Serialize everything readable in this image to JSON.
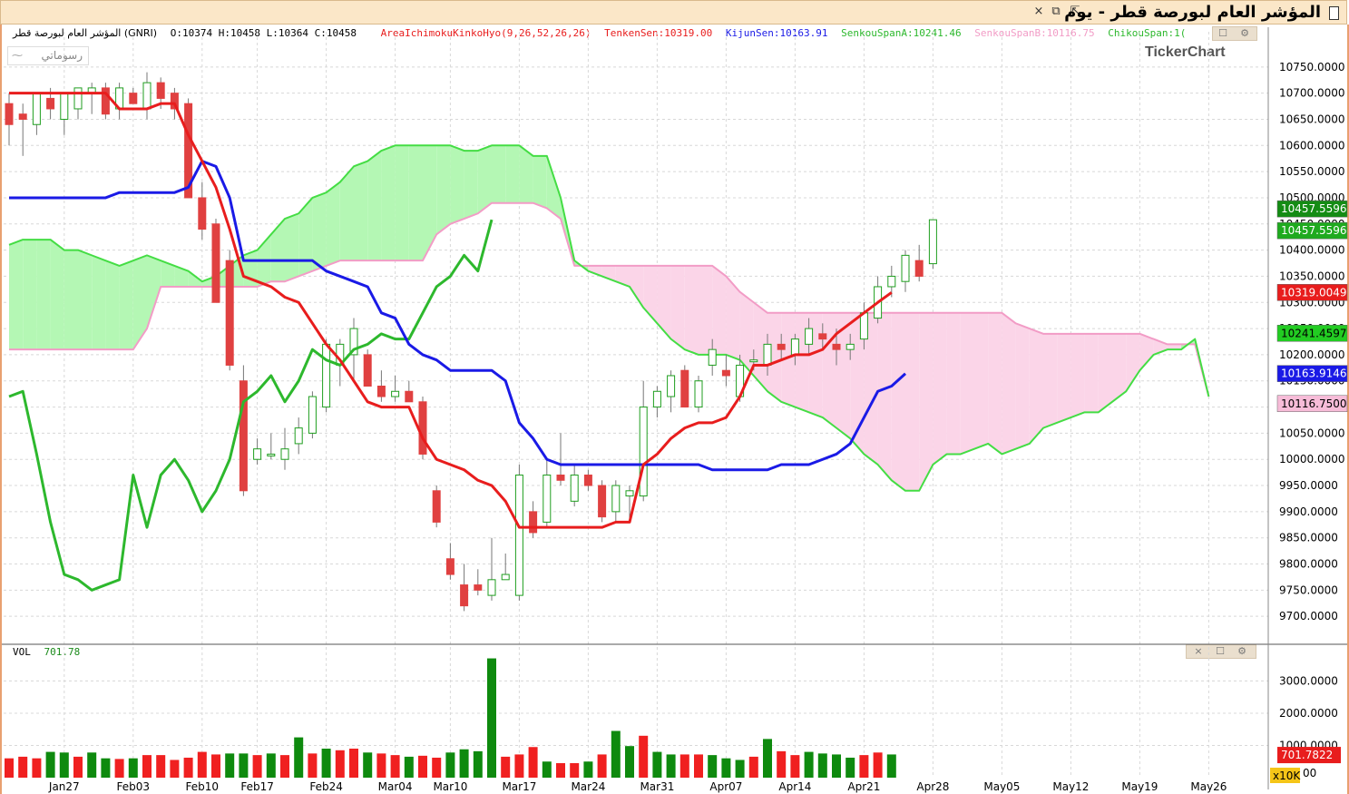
{
  "window": {
    "title": "المؤشر العام لبورصة قطر - يوم",
    "close_label": "×",
    "restore_label": "⧉",
    "detach_label": "⇱"
  },
  "legend": {
    "symbol_info": "المؤشر العام لبورصة قطر (GNRI)",
    "ohlc": "O:10374  H:10458  L:10364  C:10458",
    "indicator": "AreaIchimokuKinkoHyo(9,26,52,26,26)",
    "tenken": "TenkenSen:10319.00",
    "kijun": "KijunSen:10163.91",
    "spanA": "SenkouSpanA:10241.46",
    "spanB": "SenkouSpanB:10116.75",
    "chikou": "ChikouSpan:1("
  },
  "chart_type_label": "رسوماتي",
  "logo": "TickerChart",
  "volume_panel": {
    "label": "VOL",
    "value": "701.78",
    "multiplier": "x10K"
  },
  "colors": {
    "up": "#1f9e1f",
    "down": "#e04040",
    "tenken": "#e81d1d",
    "kijun": "#1a1ae6",
    "chikou": "#2db82d",
    "spanA": "#44dd44",
    "spanB": "#f29cc6",
    "cloud_bull": "#b4f7b4",
    "cloud_bear": "#fbd5e8",
    "volume_up": "#0e8a0e",
    "volume_down": "#f02020"
  },
  "chart_data": {
    "type": "candlestick",
    "x_tick_labels": [
      "Jan27",
      "Feb03",
      "Feb10",
      "Feb17",
      "Feb24",
      "Mar04",
      "Mar10",
      "Mar17",
      "Mar24",
      "Mar31",
      "Apr07",
      "Apr14",
      "Apr21",
      "Apr28",
      "May05",
      "May12",
      "May19",
      "May26"
    ],
    "x_tick_index": [
      4,
      9,
      14,
      18,
      23,
      28,
      32,
      37,
      42,
      47,
      52,
      57,
      62,
      67,
      72,
      77,
      82,
      87
    ],
    "ylim": [
      9650,
      10800
    ],
    "y_ticks": [
      9700,
      9750,
      9800,
      9850,
      9900,
      9950,
      10000,
      10050,
      10100,
      10150,
      10200,
      10250,
      10300,
      10350,
      10400,
      10450,
      10500,
      10550,
      10600,
      10650,
      10700,
      10750
    ],
    "candles": [
      {
        "o": 10680,
        "h": 10700,
        "l": 10600,
        "c": 10640
      },
      {
        "o": 10660,
        "h": 10680,
        "l": 10580,
        "c": 10650
      },
      {
        "o": 10640,
        "h": 10700,
        "l": 10620,
        "c": 10700
      },
      {
        "o": 10690,
        "h": 10710,
        "l": 10650,
        "c": 10670
      },
      {
        "o": 10650,
        "h": 10700,
        "l": 10620,
        "c": 10700
      },
      {
        "o": 10670,
        "h": 10710,
        "l": 10650,
        "c": 10710
      },
      {
        "o": 10700,
        "h": 10720,
        "l": 10660,
        "c": 10710
      },
      {
        "o": 10710,
        "h": 10720,
        "l": 10650,
        "c": 10660
      },
      {
        "o": 10670,
        "h": 10720,
        "l": 10650,
        "c": 10710
      },
      {
        "o": 10700,
        "h": 10710,
        "l": 10680,
        "c": 10680
      },
      {
        "o": 10670,
        "h": 10740,
        "l": 10650,
        "c": 10720
      },
      {
        "o": 10720,
        "h": 10730,
        "l": 10670,
        "c": 10690
      },
      {
        "o": 10700,
        "h": 10710,
        "l": 10650,
        "c": 10670
      },
      {
        "o": 10680,
        "h": 10690,
        "l": 10500,
        "c": 10500
      },
      {
        "o": 10500,
        "h": 10530,
        "l": 10420,
        "c": 10440
      },
      {
        "o": 10450,
        "h": 10460,
        "l": 10300,
        "c": 10300
      },
      {
        "o": 10380,
        "h": 10400,
        "l": 10170,
        "c": 10180
      },
      {
        "o": 10150,
        "h": 10180,
        "l": 9930,
        "c": 9940
      },
      {
        "o": 10000,
        "h": 10040,
        "l": 9990,
        "c": 10020
      },
      {
        "o": 10010,
        "h": 10050,
        "l": 10000,
        "c": 10010
      },
      {
        "o": 10000,
        "h": 10060,
        "l": 9980,
        "c": 10020
      },
      {
        "o": 10030,
        "h": 10080,
        "l": 10010,
        "c": 10060
      },
      {
        "o": 10050,
        "h": 10130,
        "l": 10040,
        "c": 10120
      },
      {
        "o": 10100,
        "h": 10230,
        "l": 10090,
        "c": 10220
      },
      {
        "o": 10180,
        "h": 10230,
        "l": 10140,
        "c": 10220
      },
      {
        "o": 10200,
        "h": 10270,
        "l": 10150,
        "c": 10250
      },
      {
        "o": 10200,
        "h": 10210,
        "l": 10140,
        "c": 10140
      },
      {
        "o": 10140,
        "h": 10170,
        "l": 10110,
        "c": 10120
      },
      {
        "o": 10120,
        "h": 10160,
        "l": 10110,
        "c": 10130
      },
      {
        "o": 10130,
        "h": 10150,
        "l": 10120,
        "c": 10110
      },
      {
        "o": 10110,
        "h": 10120,
        "l": 10000,
        "c": 10010
      },
      {
        "o": 9940,
        "h": 9950,
        "l": 9870,
        "c": 9880
      },
      {
        "o": 9810,
        "h": 9840,
        "l": 9770,
        "c": 9780
      },
      {
        "o": 9760,
        "h": 9800,
        "l": 9710,
        "c": 9720
      },
      {
        "o": 9760,
        "h": 9790,
        "l": 9740,
        "c": 9750
      },
      {
        "o": 9740,
        "h": 9850,
        "l": 9730,
        "c": 9770
      },
      {
        "o": 9770,
        "h": 9820,
        "l": 9770,
        "c": 9780
      },
      {
        "o": 9740,
        "h": 9990,
        "l": 9730,
        "c": 9970
      },
      {
        "o": 9900,
        "h": 9920,
        "l": 9850,
        "c": 9860
      },
      {
        "o": 9880,
        "h": 10000,
        "l": 9870,
        "c": 9970
      },
      {
        "o": 9970,
        "h": 10050,
        "l": 9950,
        "c": 9960
      },
      {
        "o": 9920,
        "h": 9990,
        "l": 9910,
        "c": 9970
      },
      {
        "o": 9970,
        "h": 9980,
        "l": 9940,
        "c": 9950
      },
      {
        "o": 9950,
        "h": 9960,
        "l": 9880,
        "c": 9890
      },
      {
        "o": 9900,
        "h": 9960,
        "l": 9880,
        "c": 9950
      },
      {
        "o": 9930,
        "h": 9950,
        "l": 9880,
        "c": 9940
      },
      {
        "o": 9930,
        "h": 10150,
        "l": 9920,
        "c": 10100
      },
      {
        "o": 10100,
        "h": 10140,
        "l": 10080,
        "c": 10130
      },
      {
        "o": 10120,
        "h": 10170,
        "l": 10090,
        "c": 10160
      },
      {
        "o": 10170,
        "h": 10180,
        "l": 10100,
        "c": 10100
      },
      {
        "o": 10100,
        "h": 10160,
        "l": 10090,
        "c": 10150
      },
      {
        "o": 10180,
        "h": 10230,
        "l": 10160,
        "c": 10210
      },
      {
        "o": 10170,
        "h": 10200,
        "l": 10140,
        "c": 10160
      },
      {
        "o": 10120,
        "h": 10200,
        "l": 10110,
        "c": 10180
      },
      {
        "o": 10190,
        "h": 10210,
        "l": 10170,
        "c": 10190
      },
      {
        "o": 10180,
        "h": 10240,
        "l": 10160,
        "c": 10220
      },
      {
        "o": 10220,
        "h": 10240,
        "l": 10190,
        "c": 10210
      },
      {
        "o": 10200,
        "h": 10240,
        "l": 10180,
        "c": 10230
      },
      {
        "o": 10220,
        "h": 10270,
        "l": 10200,
        "c": 10250
      },
      {
        "o": 10240,
        "h": 10260,
        "l": 10210,
        "c": 10230
      },
      {
        "o": 10220,
        "h": 10250,
        "l": 10180,
        "c": 10210
      },
      {
        "o": 10210,
        "h": 10240,
        "l": 10190,
        "c": 10220
      },
      {
        "o": 10230,
        "h": 10300,
        "l": 10210,
        "c": 10280
      },
      {
        "o": 10270,
        "h": 10350,
        "l": 10260,
        "c": 10330
      },
      {
        "o": 10330,
        "h": 10370,
        "l": 10310,
        "c": 10350
      },
      {
        "o": 10340,
        "h": 10400,
        "l": 10320,
        "c": 10390
      },
      {
        "o": 10380,
        "h": 10410,
        "l": 10340,
        "c": 10350
      },
      {
        "o": 10374,
        "h": 10458,
        "l": 10364,
        "c": 10458
      }
    ],
    "tenken": [
      10700,
      10700,
      10700,
      10700,
      10700,
      10700,
      10700,
      10700,
      10670,
      10670,
      10670,
      10680,
      10680,
      10620,
      10570,
      10520,
      10440,
      10350,
      10340,
      10330,
      10310,
      10300,
      10260,
      10220,
      10190,
      10150,
      10110,
      10100,
      10100,
      10100,
      10040,
      10000,
      9990,
      9980,
      9960,
      9950,
      9920,
      9870,
      9870,
      9870,
      9870,
      9870,
      9870,
      9870,
      9880,
      9880,
      9990,
      10010,
      10040,
      10060,
      10070,
      10070,
      10080,
      10120,
      10180,
      10180,
      10190,
      10200,
      10200,
      10210,
      10240,
      10260,
      10280,
      10300,
      10319
    ],
    "kijun": [
      10500,
      10500,
      10500,
      10500,
      10500,
      10500,
      10500,
      10500,
      10510,
      10510,
      10510,
      10510,
      10510,
      10520,
      10570,
      10560,
      10500,
      10380,
      10380,
      10380,
      10380,
      10380,
      10380,
      10360,
      10350,
      10340,
      10330,
      10280,
      10270,
      10220,
      10200,
      10190,
      10170,
      10170,
      10170,
      10170,
      10150,
      10070,
      10040,
      10000,
      9990,
      9990,
      9990,
      9990,
      9990,
      9990,
      9990,
      9990,
      9990,
      9990,
      9990,
      9980,
      9980,
      9980,
      9980,
      9980,
      9990,
      9990,
      9990,
      10000,
      10010,
      10030,
      10080,
      10130,
      10140,
      10163.91
    ],
    "spanA": {
      "start": 0,
      "values": [
        10410,
        10420,
        10420,
        10420,
        10400,
        10400,
        10390,
        10380,
        10370,
        10380,
        10390,
        10380,
        10370,
        10360,
        10340,
        10350,
        10370,
        10390,
        10400,
        10430,
        10460,
        10470,
        10500,
        10510,
        10530,
        10560,
        10570,
        10590,
        10600,
        10600,
        10600,
        10600,
        10600,
        10590,
        10590,
        10600,
        10600,
        10600,
        10580,
        10580,
        10500,
        10380,
        10360,
        10350,
        10340,
        10330,
        10290,
        10260,
        10230,
        10210,
        10200,
        10200,
        10200,
        10190,
        10160,
        10130,
        10110,
        10100,
        10090,
        10080,
        10060,
        10040,
        10010,
        9990,
        9960,
        9940,
        9940,
        9990,
        10010,
        10010,
        10020,
        10030,
        10010,
        10020,
        10030,
        10060,
        10070,
        10080,
        10090,
        10090,
        10110,
        10130,
        10170,
        10200,
        10210,
        10210,
        10230,
        10120
      ]
    },
    "spanB": {
      "start": 0,
      "values": [
        10210,
        10210,
        10210,
        10210,
        10210,
        10210,
        10210,
        10210,
        10210,
        10210,
        10250,
        10330,
        10330,
        10330,
        10330,
        10330,
        10330,
        10330,
        10330,
        10340,
        10340,
        10350,
        10360,
        10370,
        10380,
        10380,
        10380,
        10380,
        10380,
        10380,
        10380,
        10430,
        10450,
        10460,
        10470,
        10490,
        10490,
        10490,
        10490,
        10480,
        10460,
        10370,
        10370,
        10370,
        10370,
        10370,
        10370,
        10370,
        10370,
        10370,
        10370,
        10370,
        10350,
        10320,
        10300,
        10280,
        10280,
        10280,
        10280,
        10280,
        10280,
        10280,
        10280,
        10280,
        10280,
        10280,
        10280,
        10280,
        10280,
        10280,
        10280,
        10280,
        10280,
        10260,
        10250,
        10240,
        10240,
        10240,
        10240,
        10240,
        10240,
        10240,
        10240,
        10230,
        10220,
        10220,
        10220,
        10120
      ]
    },
    "chikou": {
      "start": 0,
      "values": [
        10120,
        10130,
        10010,
        9880,
        9780,
        9770,
        9750,
        9760,
        9770,
        9970,
        9870,
        9970,
        10000,
        9960,
        9900,
        9940,
        10000,
        10110,
        10130,
        10160,
        10110,
        10150,
        10210,
        10190,
        10180,
        10210,
        10220,
        10240,
        10230,
        10230,
        10280,
        10330,
        10350,
        10390,
        10360,
        10458
      ]
    },
    "volume": [
      {
        "v": 60,
        "u": 0
      },
      {
        "v": 65,
        "u": 0
      },
      {
        "v": 60,
        "u": 0
      },
      {
        "v": 80,
        "u": 1
      },
      {
        "v": 78,
        "u": 1
      },
      {
        "v": 65,
        "u": 0
      },
      {
        "v": 78,
        "u": 1
      },
      {
        "v": 60,
        "u": 1
      },
      {
        "v": 58,
        "u": 0
      },
      {
        "v": 60,
        "u": 1
      },
      {
        "v": 70,
        "u": 0
      },
      {
        "v": 70,
        "u": 0
      },
      {
        "v": 55,
        "u": 0
      },
      {
        "v": 62,
        "u": 0
      },
      {
        "v": 80,
        "u": 0
      },
      {
        "v": 72,
        "u": 0
      },
      {
        "v": 75,
        "u": 1
      },
      {
        "v": 75,
        "u": 1
      },
      {
        "v": 70,
        "u": 0
      },
      {
        "v": 75,
        "u": 1
      },
      {
        "v": 70,
        "u": 0
      },
      {
        "v": 125,
        "u": 1
      },
      {
        "v": 75,
        "u": 0
      },
      {
        "v": 90,
        "u": 1
      },
      {
        "v": 85,
        "u": 0
      },
      {
        "v": 90,
        "u": 0
      },
      {
        "v": 78,
        "u": 1
      },
      {
        "v": 75,
        "u": 0
      },
      {
        "v": 70,
        "u": 0
      },
      {
        "v": 65,
        "u": 1
      },
      {
        "v": 68,
        "u": 0
      },
      {
        "v": 62,
        "u": 0
      },
      {
        "v": 78,
        "u": 1
      },
      {
        "v": 88,
        "u": 1
      },
      {
        "v": 82,
        "u": 1
      },
      {
        "v": 370,
        "u": 1
      },
      {
        "v": 65,
        "u": 0
      },
      {
        "v": 72,
        "u": 0
      },
      {
        "v": 95,
        "u": 0
      },
      {
        "v": 50,
        "u": 1
      },
      {
        "v": 45,
        "u": 0
      },
      {
        "v": 45,
        "u": 0
      },
      {
        "v": 50,
        "u": 1
      },
      {
        "v": 72,
        "u": 0
      },
      {
        "v": 145,
        "u": 1
      },
      {
        "v": 98,
        "u": 1
      },
      {
        "v": 130,
        "u": 0
      },
      {
        "v": 80,
        "u": 1
      },
      {
        "v": 72,
        "u": 1
      },
      {
        "v": 72,
        "u": 0
      },
      {
        "v": 72,
        "u": 0
      },
      {
        "v": 70,
        "u": 1
      },
      {
        "v": 60,
        "u": 1
      },
      {
        "v": 55,
        "u": 1
      },
      {
        "v": 65,
        "u": 0
      },
      {
        "v": 120,
        "u": 1
      },
      {
        "v": 82,
        "u": 0
      },
      {
        "v": 70,
        "u": 0
      },
      {
        "v": 80,
        "u": 1
      },
      {
        "v": 75,
        "u": 1
      },
      {
        "v": 72,
        "u": 1
      },
      {
        "v": 62,
        "u": 1
      },
      {
        "v": 70,
        "u": 0
      },
      {
        "v": 78,
        "u": 0
      },
      {
        "v": 72,
        "u": 1
      }
    ],
    "volume_ticks": [
      1000,
      2000,
      3000
    ],
    "volume_ylim": [
      0,
      3800
    ],
    "price_labels": [
      {
        "text": "10457.5596",
        "value": 10458,
        "bg": "#148c14",
        "fg": "#ffffff",
        "offset": -12
      },
      {
        "text": "10457.5596",
        "value": 10458,
        "bg": "#1faa1f",
        "fg": "#ffffff",
        "offset": 12
      },
      {
        "text": "10319.0049",
        "value": 10319,
        "bg": "#e81d1d",
        "fg": "#ffffff",
        "offset": 0
      },
      {
        "text": "10241.4597",
        "value": 10241,
        "bg": "#22cc22",
        "fg": "#000000",
        "offset": 0
      },
      {
        "text": "10163.9146",
        "value": 10164,
        "bg": "#1a1ae6",
        "fg": "#ffffff",
        "offset": 0
      },
      {
        "text": "10116.7500",
        "value": 10117,
        "bg": "#f7bcd8",
        "fg": "#000000",
        "offset": 6
      }
    ],
    "volume_price_label": {
      "text": "701.7822",
      "bg": "#e81d1d",
      "fg": "#ffffff"
    }
  }
}
